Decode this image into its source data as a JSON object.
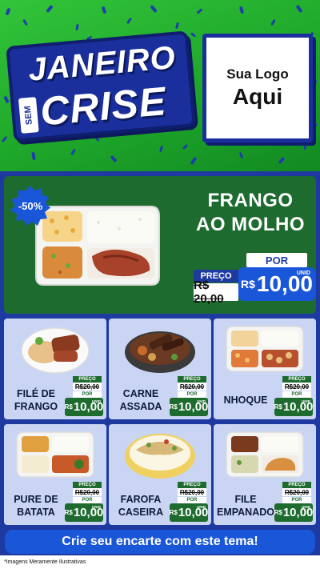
{
  "colors": {
    "header_green": "#1ea72a",
    "navy": "#1e3aa0",
    "hero_green": "#1d6b2f",
    "price_blue": "#1a56d8",
    "card_bg": "#c9d5f3"
  },
  "header": {
    "title_line1": "JANEIRO",
    "title_sem": "SEM",
    "title_line2": "CRISE",
    "logo_line1": "Sua Logo",
    "logo_line2": "Aqui"
  },
  "hero": {
    "discount": "-50%",
    "name_line1": "FRANGO",
    "name_line2": "AO MOLHO",
    "preco_label": "PREÇO",
    "old_price": "R$ 20,00",
    "por_label": "POR",
    "currency": "R$",
    "new_price": "10,00",
    "unit": "UNID",
    "image_icon": "meal-tray-image"
  },
  "products": [
    {
      "name_line1": "FILÉ DE",
      "name_line2": "FRANGO",
      "preco_label": "PREÇO",
      "old_price": "R$20,00",
      "por_label": "POR",
      "currency": "R$",
      "new_price": "10,00",
      "unit": "UNID",
      "image_icon": "plate-filet-image"
    },
    {
      "name_line1": "CARNE",
      "name_line2": "ASSADA",
      "preco_label": "PREÇO",
      "old_price": "R$20,00",
      "por_label": "POR",
      "currency": "R$",
      "new_price": "10,00",
      "unit": "UNID",
      "image_icon": "bowl-meat-image"
    },
    {
      "name_line1": "NHOQUE",
      "name_line2": "",
      "preco_label": "PREÇO",
      "old_price": "R$20,00",
      "por_label": "POR",
      "currency": "R$",
      "new_price": "10,00",
      "unit": "UNID",
      "image_icon": "tray-gnocchi-image"
    },
    {
      "name_line1": "PURE DE",
      "name_line2": "BATATA",
      "preco_label": "PREÇO",
      "old_price": "R$20,00",
      "por_label": "POR",
      "currency": "R$",
      "new_price": "10,00",
      "unit": "UNID",
      "image_icon": "tray-puree-image"
    },
    {
      "name_line1": "FAROFA",
      "name_line2": "CASEIRA",
      "preco_label": "PREÇO",
      "old_price": "R$20,00",
      "por_label": "POR",
      "currency": "R$",
      "new_price": "10,00",
      "unit": "UNID",
      "image_icon": "bowl-farofa-image"
    },
    {
      "name_line1": "FILE",
      "name_line2": "EMPANADO",
      "preco_label": "PREÇO",
      "old_price": "R$20,00",
      "por_label": "POR",
      "currency": "R$",
      "new_price": "10,00",
      "unit": "UNID",
      "image_icon": "tray-breaded-image"
    }
  ],
  "cta": "Crie seu encarte com este tema!",
  "disclaimer": "*Imagens Meramente Ilustrativas"
}
